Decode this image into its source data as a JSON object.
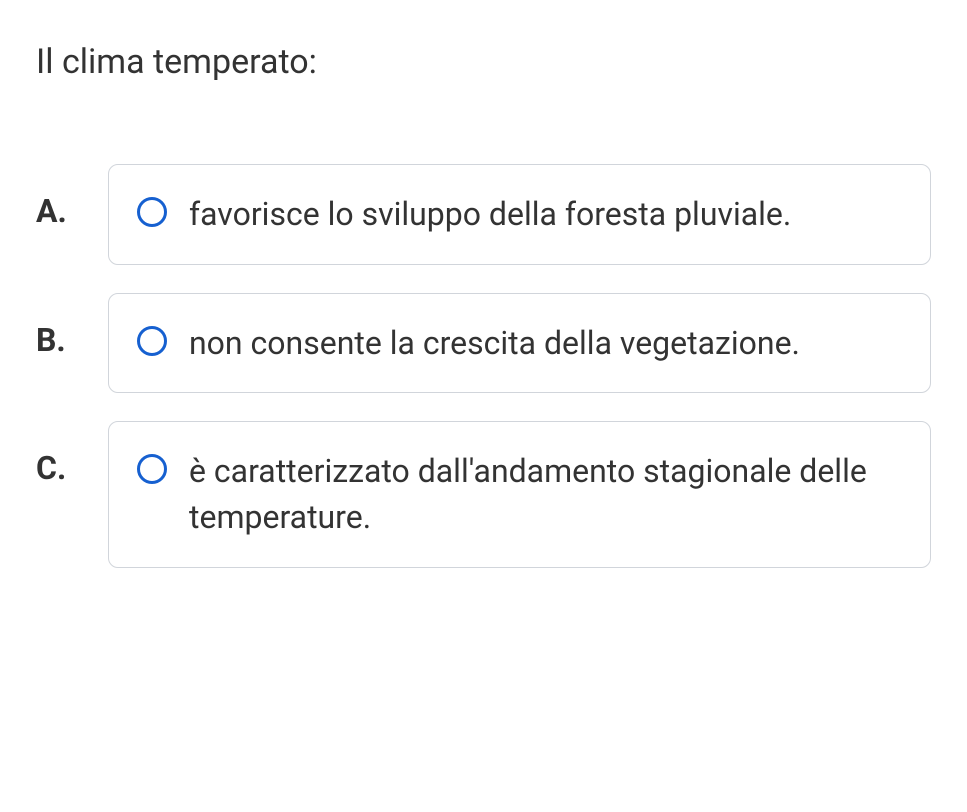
{
  "question": "Il clima temperato:",
  "options": [
    {
      "letter": "A.",
      "text": "favorisce lo sviluppo della foresta pluviale."
    },
    {
      "letter": "B.",
      "text": "non consente la crescita della vegetazione."
    },
    {
      "letter": "C.",
      "text": "è caratterizzato dall'andamento stagionale delle temperature."
    }
  ]
}
